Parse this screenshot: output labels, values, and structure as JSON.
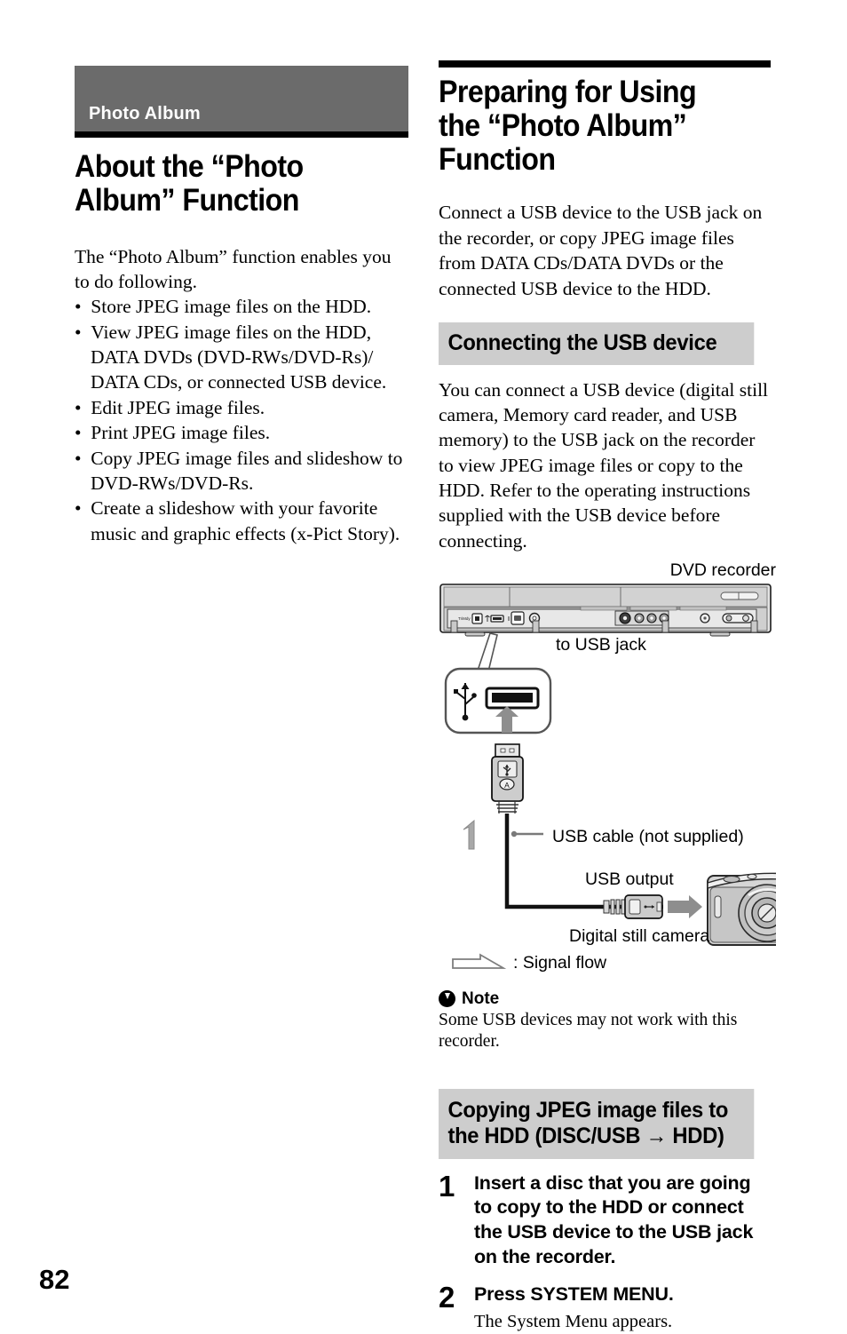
{
  "page": {
    "number": "82"
  },
  "left_column": {
    "chapter_banner": "Photo Album",
    "section_title": "About the “Photo Album” Function",
    "intro": "The “Photo Album” function enables you to do following.",
    "bullets": [
      "Store JPEG image files on the HDD.",
      "View JPEG image files on the HDD, DATA DVDs (DVD-RWs/DVD-Rs)/ DATA CDs, or connected USB device.",
      "Edit JPEG image files.",
      "Print JPEG image files.",
      "Copy JPEG image files and slideshow to DVD-RWs/DVD-Rs.",
      "Create a slideshow with your favorite music and graphic effects (x-Pict Story)."
    ]
  },
  "right_column": {
    "main_title": "Preparing for Using the “Photo Album” Function",
    "intro": "Connect a USB device to the USB jack on the recorder, or copy JPEG image files from DATA CDs/DATA DVDs or the connected USB device to the HDD.",
    "subsection_1": {
      "heading": "Connecting the USB device",
      "body": "You can connect a USB device (digital still camera, Memory card reader, and USB memory) to the USB jack on the recorder to view JPEG image files or copy to the HDD. Refer to the operating instructions supplied with the USB device before connecting."
    },
    "diagram": {
      "dvd_recorder_label": "DVD recorder",
      "to_usb_jack_label": "to USB jack",
      "usb_cable_label": "USB cable (not supplied)",
      "usb_output_label": "USB output",
      "digital_still_camera_label": "Digital still camera",
      "usb_plug_marking_a": "A",
      "legend_text": ": Signal flow"
    },
    "note": {
      "heading": "Note",
      "body": "Some USB devices may not work with this recorder."
    },
    "subsection_2": {
      "heading_line_1": "Copying JPEG image files to",
      "heading_line_2": "the HDD (DISC/USB → HDD)",
      "steps": [
        {
          "number": "1",
          "title": "Insert a disc that you are going to copy to the HDD or connect the USB device to the USB jack on the recorder.",
          "description": ""
        },
        {
          "number": "2",
          "title": "Press SYSTEM MENU.",
          "description": "The System Menu appears."
        }
      ]
    }
  },
  "colors": {
    "chapter_banner_bg": "#6b6b6b",
    "section_head_bg": "#cdcdcd",
    "rule": "#000000",
    "diagram_gray": "#9a9a9a"
  }
}
